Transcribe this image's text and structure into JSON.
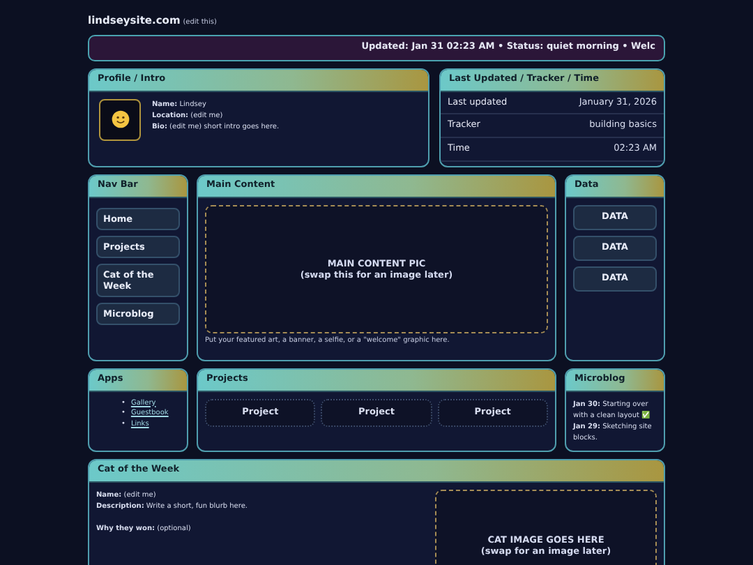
{
  "site": {
    "title": "lindseysite.com",
    "edit": "(edit this)"
  },
  "ticker": "Updated: Jan 31 02:23 AM • Status: quiet morning • Welc",
  "profile": {
    "header": "Profile / Intro",
    "fields": [
      "**Name:** Lindsey",
      "**Location:** (edit me)",
      "**Bio:** (edit me) short intro goes here."
    ]
  },
  "tracker": {
    "header": "Last Updated / Tracker / Time",
    "rows": [
      {
        "label": "Last updated",
        "value": "January 31, 2026"
      },
      {
        "label": "Tracker",
        "value": "building basics"
      },
      {
        "label": "Time",
        "value": "02:23 AM"
      }
    ]
  },
  "nav": {
    "header": "Nav Bar",
    "items": [
      "Home",
      "Projects",
      "Cat of the Week",
      "Microblog"
    ]
  },
  "main": {
    "header": "Main Content",
    "pic_lines": [
      "MAIN CONTENT PIC",
      "(swap this for an image later)"
    ],
    "caption": "Put your featured art, a banner, a selfie, or a \"welcome\" graphic here."
  },
  "data": {
    "header": "Data",
    "buttons": [
      "DATA",
      "DATA",
      "DATA"
    ]
  },
  "apps": {
    "header": "Apps",
    "links": [
      {
        "marker": "•",
        "label": "Gallery"
      },
      {
        "marker": "•",
        "label": "Guestbook"
      },
      {
        "marker": "•",
        "label": "Links"
      }
    ]
  },
  "projects": {
    "header": "Projects",
    "items": [
      "Project",
      "Project",
      "Project"
    ]
  },
  "microblog": {
    "header": "Microblog",
    "entries": [
      "**Jan 30:** Starting over with a clean layout ✅",
      "**Jan 29:** Sketching site blocks."
    ]
  },
  "cat": {
    "header": "Cat of the Week",
    "fields": [
      "**Name:** (edit me)",
      "**Description:** Write a short, fun blurb here.",
      "**Why they won:** (optional)"
    ],
    "pic_lines": [
      "CAT IMAGE GOES HERE",
      "(swap for an image later)"
    ]
  }
}
